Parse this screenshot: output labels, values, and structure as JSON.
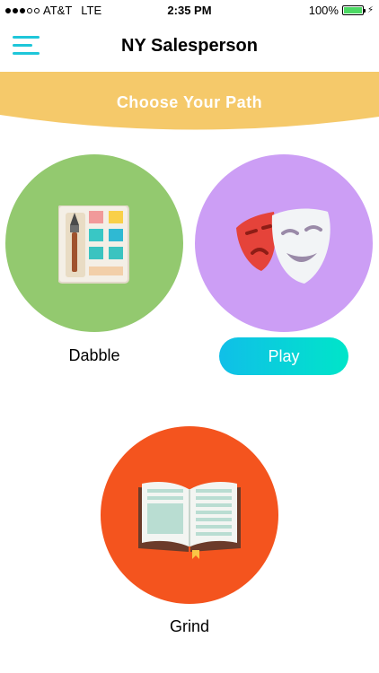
{
  "status_bar": {
    "carrier": "AT&T",
    "network": "LTE",
    "time": "2:35 PM",
    "battery": "100%",
    "battery_level": 1.0
  },
  "header": {
    "title": "NY Salesperson",
    "menu_icon": "hamburger-menu-icon"
  },
  "banner": {
    "text": "Choose Your Path",
    "color": "#f5c96a"
  },
  "paths": {
    "dabble": {
      "label": "Dabble",
      "icon": "paint-palette-icon",
      "color": "#93c96f"
    },
    "play": {
      "label": "Play",
      "icon": "theater-masks-icon",
      "color": "#cc9ef5"
    },
    "grind": {
      "label": "Grind",
      "icon": "open-book-icon",
      "color": "#f4541e"
    }
  },
  "colors": {
    "accent": "#1ec6d9",
    "play_gradient_start": "#10bfe8",
    "play_gradient_end": "#00e5c9"
  }
}
